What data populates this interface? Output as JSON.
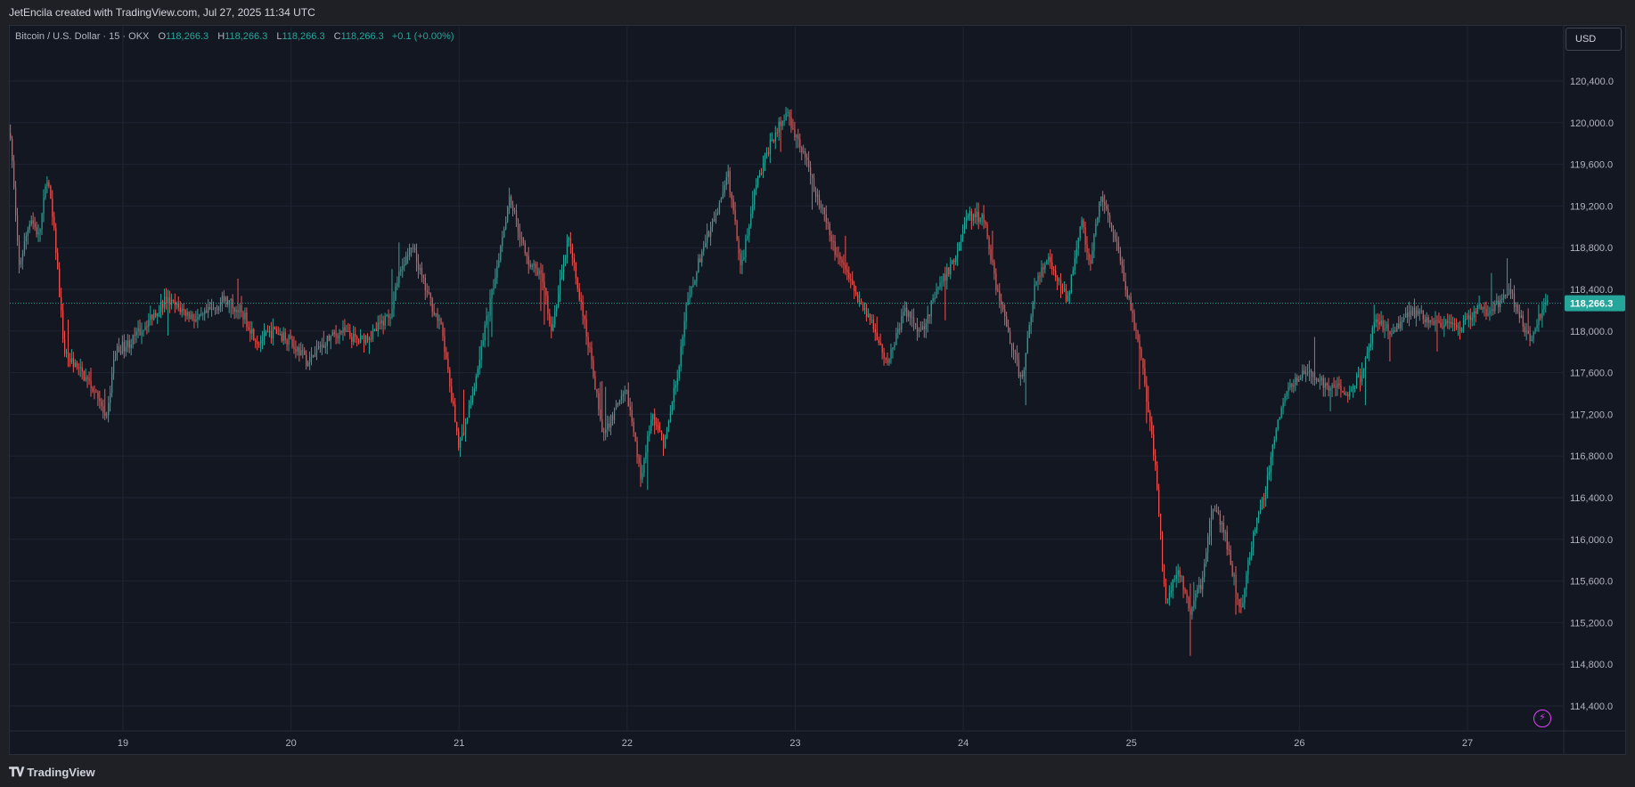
{
  "header": {
    "credit": "JetEncila created with TradingView.com, Jul 27, 2025 11:34 UTC"
  },
  "legend": {
    "symbol": "Bitcoin / U.S. Dollar · 15 · OKX",
    "open_label": "O",
    "open": "118,266.3",
    "high_label": "H",
    "high": "118,266.3",
    "low_label": "L",
    "low": "118,266.3",
    "close_label": "C",
    "close": "118,266.3",
    "change": "+0.1 (+0.00%)"
  },
  "currency": "USD",
  "footer": {
    "brand": "TradingView"
  },
  "colors": {
    "up": "#26a69a",
    "down": "#ef5350",
    "background": "#131722",
    "grid": "#1f2433",
    "price_tag": "#26a69a"
  },
  "icons": {
    "lightning": "lightning-icon",
    "logo": "tradingview-logo-icon"
  },
  "chart_data": {
    "type": "candlestick",
    "symbol": "Bitcoin / U.S. Dollar",
    "interval": "15",
    "exchange": "OKX",
    "x_tick_labels": [
      "19",
      "20",
      "21",
      "22",
      "23",
      "24",
      "25",
      "26",
      "27"
    ],
    "y_tick_labels": [
      "120,400.0",
      "120,000.0",
      "119,600.0",
      "119,200.0",
      "118,800.0",
      "118,400.0",
      "118,000.0",
      "117,600.0",
      "117,200.0",
      "116,800.0",
      "116,400.0",
      "116,000.0",
      "115,600.0",
      "115,200.0",
      "114,800.0",
      "114,400.0"
    ],
    "y_ticks": [
      120400,
      120000,
      119600,
      119200,
      118800,
      118400,
      118000,
      117600,
      117200,
      116800,
      116400,
      116000,
      115600,
      115200,
      114800,
      114400
    ],
    "ylim": [
      114200,
      120700
    ],
    "xlim": [
      18.33,
      27.52
    ],
    "current_price": 118266.3,
    "current_price_label": "118,266.3",
    "grid": true,
    "path_points": [
      [
        18.33,
        119900
      ],
      [
        18.38,
        118600
      ],
      [
        18.45,
        119100
      ],
      [
        18.5,
        118900
      ],
      [
        18.55,
        119500
      ],
      [
        18.6,
        118800
      ],
      [
        18.65,
        117800
      ],
      [
        18.75,
        117600
      ],
      [
        18.85,
        117400
      ],
      [
        18.9,
        117100
      ],
      [
        18.95,
        117800
      ],
      [
        19.05,
        117900
      ],
      [
        19.15,
        118100
      ],
      [
        19.25,
        118300
      ],
      [
        19.35,
        118200
      ],
      [
        19.45,
        118100
      ],
      [
        19.6,
        118300
      ],
      [
        19.7,
        118200
      ],
      [
        19.8,
        117900
      ],
      [
        19.9,
        118000
      ],
      [
        20.0,
        117900
      ],
      [
        20.1,
        117700
      ],
      [
        20.2,
        117900
      ],
      [
        20.3,
        118000
      ],
      [
        20.4,
        117900
      ],
      [
        20.5,
        118000
      ],
      [
        20.6,
        118200
      ],
      [
        20.65,
        118600
      ],
      [
        20.72,
        118800
      ],
      [
        20.8,
        118400
      ],
      [
        20.9,
        118000
      ],
      [
        20.95,
        117400
      ],
      [
        21.0,
        116900
      ],
      [
        21.07,
        117300
      ],
      [
        21.15,
        118000
      ],
      [
        21.2,
        118400
      ],
      [
        21.3,
        119300
      ],
      [
        21.4,
        118700
      ],
      [
        21.5,
        118500
      ],
      [
        21.55,
        118000
      ],
      [
        21.65,
        118900
      ],
      [
        21.72,
        118300
      ],
      [
        21.8,
        117600
      ],
      [
        21.85,
        117000
      ],
      [
        21.95,
        117300
      ],
      [
        22.0,
        117400
      ],
      [
        22.08,
        116600
      ],
      [
        22.15,
        117200
      ],
      [
        22.22,
        116900
      ],
      [
        22.3,
        117600
      ],
      [
        22.35,
        118200
      ],
      [
        22.45,
        118800
      ],
      [
        22.55,
        119200
      ],
      [
        22.6,
        119500
      ],
      [
        22.68,
        118600
      ],
      [
        22.75,
        119300
      ],
      [
        22.85,
        119800
      ],
      [
        22.95,
        120100
      ],
      [
        23.05,
        119700
      ],
      [
        23.15,
        119200
      ],
      [
        23.25,
        118700
      ],
      [
        23.35,
        118400
      ],
      [
        23.45,
        118100
      ],
      [
        23.55,
        117700
      ],
      [
        23.65,
        118200
      ],
      [
        23.75,
        118000
      ],
      [
        23.85,
        118400
      ],
      [
        23.95,
        118700
      ],
      [
        24.02,
        119100
      ],
      [
        24.12,
        119100
      ],
      [
        24.2,
        118400
      ],
      [
        24.28,
        117900
      ],
      [
        24.35,
        117500
      ],
      [
        24.42,
        118400
      ],
      [
        24.5,
        118700
      ],
      [
        24.55,
        118500
      ],
      [
        24.62,
        118300
      ],
      [
        24.7,
        119100
      ],
      [
        24.75,
        118600
      ],
      [
        24.82,
        119300
      ],
      [
        24.9,
        118900
      ],
      [
        25.0,
        118200
      ],
      [
        25.07,
        117600
      ],
      [
        25.15,
        116600
      ],
      [
        25.2,
        115400
      ],
      [
        25.28,
        115700
      ],
      [
        25.35,
        115300
      ],
      [
        25.42,
        115600
      ],
      [
        25.48,
        116300
      ],
      [
        25.55,
        116100
      ],
      [
        25.6,
        115700
      ],
      [
        25.65,
        115300
      ],
      [
        25.72,
        116000
      ],
      [
        25.8,
        116500
      ],
      [
        25.88,
        117200
      ],
      [
        25.95,
        117500
      ],
      [
        26.05,
        117600
      ],
      [
        26.15,
        117500
      ],
      [
        26.28,
        117400
      ],
      [
        26.38,
        117600
      ],
      [
        26.45,
        118100
      ],
      [
        26.55,
        118000
      ],
      [
        26.65,
        118200
      ],
      [
        26.8,
        118100
      ],
      [
        26.95,
        118000
      ],
      [
        27.05,
        118200
      ],
      [
        27.15,
        118200
      ],
      [
        27.25,
        118400
      ],
      [
        27.32,
        118100
      ],
      [
        27.38,
        117900
      ],
      [
        27.44,
        118200
      ],
      [
        27.48,
        118266
      ]
    ]
  }
}
